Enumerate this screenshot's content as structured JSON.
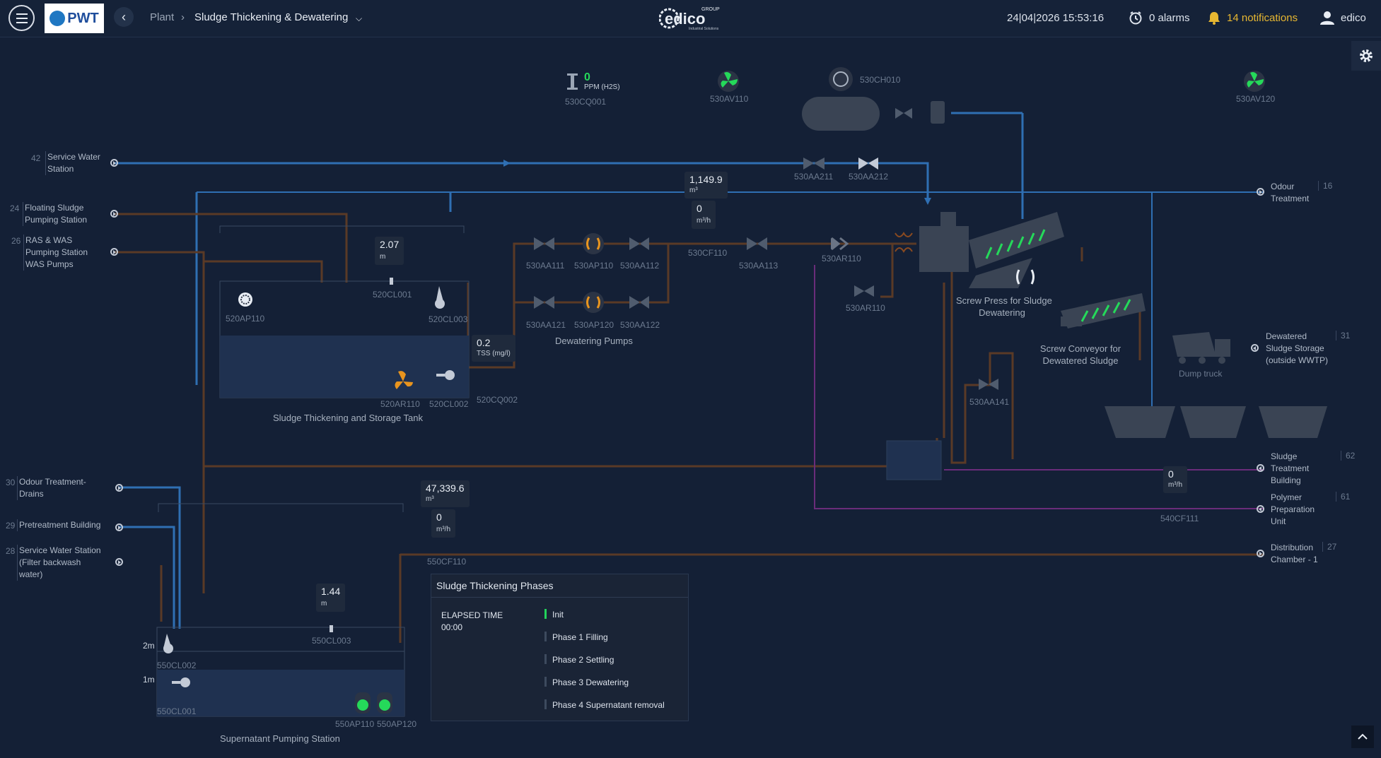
{
  "header": {
    "logo_text": "PWT",
    "crumb_root": "Plant",
    "crumb_current": "Sludge Thickening & Dewatering",
    "center_logo": "edico",
    "center_logo_group": "GROUP",
    "center_logo_sub": "Industrial Solutions",
    "datetime": "24|04|2026 15:53:16",
    "alarms": "0 alarms",
    "notifications": "14 notifications",
    "user": "edico"
  },
  "endpoints": {
    "service_water": {
      "num": "42",
      "label1": "Service Water",
      "label2": "Station"
    },
    "floating_sludge": {
      "num": "24",
      "label1": "Floating Sludge",
      "label2": "Pumping Station"
    },
    "ras_was": {
      "num": "26",
      "label1": "RAS & WAS",
      "label2": "Pumping Station",
      "label3": "WAS Pumps"
    },
    "odour_drains": {
      "num": "30",
      "label1": "Odour Treatment-",
      "label2": "Drains"
    },
    "pretreatment": {
      "num": "29",
      "label1": "Pretreatment Building"
    },
    "service_water_filter": {
      "num": "28",
      "label1": "Service Water Station",
      "label2": "(Filter backwash",
      "label3": "water)"
    },
    "odour_treatment": {
      "num": "16",
      "label1": "Odour",
      "label2": "Treatment"
    },
    "dewatered_storage": {
      "num": "31",
      "label1": "Dewatered",
      "label2": "Sludge Storage",
      "label3": "(outside WWTP)"
    },
    "sludge_treatment": {
      "num": "62",
      "label1": "Sludge",
      "label2": "Treatment",
      "label3": "Building"
    },
    "polymer": {
      "num": "61",
      "label1": "Polymer",
      "label2": "Preparation",
      "label3": "Unit"
    },
    "distribution": {
      "num": "27",
      "label1": "Distribution",
      "label2": "Chamber - 1"
    }
  },
  "tags": {
    "cq001": "530CQ001",
    "av110": "530AV110",
    "ch010": "530CH010",
    "av120": "530AV120",
    "aa211": "530AA211",
    "aa212": "530AA212",
    "cf110": "530CF110",
    "aa111": "530AA111",
    "ap110": "530AP110",
    "aa112": "530AA112",
    "aa113": "530AA113",
    "ar110a": "530AR110",
    "ar110b": "530AR110",
    "aa121": "530AA121",
    "ap120": "530AP120",
    "aa122": "530AA122",
    "aa141": "530AA141",
    "cl001": "520CL001",
    "ap110t": "520AP110",
    "cl003": "520CL003",
    "ar110t": "520AR110",
    "cl002": "520CL002",
    "cq002": "520CQ002",
    "cf111": "540CF111",
    "scf110": "550CF110",
    "s_cl003": "550CL003",
    "s_cl002": "550CL002",
    "s_cl001": "550CL001",
    "s_ap110": "550AP110",
    "s_ap120": "550AP120"
  },
  "readouts": {
    "h2s_value": "0",
    "h2s_unit": "PPM (H2S)",
    "vol_530": "1,149.9",
    "vol_530_unit": "m³",
    "flow_530": "0",
    "flow_530_unit": "m³/h",
    "level_520": "2.07",
    "level_520_unit": "m",
    "tss_520": "0.2",
    "tss_520_unit": "TSS (mg/l)",
    "flow_540": "0",
    "flow_540_unit": "m³/h",
    "vol_550": "47,339.6",
    "vol_550_unit": "m³",
    "flow_550": "0",
    "flow_550_unit": "m³/h",
    "level_550": "1.44",
    "level_550_unit": "m",
    "level_2m": "2m",
    "level_1m": "1m"
  },
  "captions": {
    "dewatering_pumps": "Dewatering Pumps",
    "screw_press": "Screw Press for Sludge",
    "screw_press2": "Dewatering",
    "screw_conveyor": "Screw Conveyor for",
    "screw_conveyor2": "Dewatered Sludge",
    "dump_truck": "Dump truck",
    "thickening_tank": "Sludge Thickening and Storage Tank",
    "supernatant": "Supernatant Pumping Station"
  },
  "phases": {
    "title": "Sludge Thickening Phases",
    "elapsed_label": "ELAPSED TIME",
    "elapsed_value": "00:00",
    "items": [
      "Init",
      "Phase 1 Filling",
      "Phase 2 Settling",
      "Phase 3 Dewatering",
      "Phase 4 Supernatant removal"
    ],
    "active_index": 0
  },
  "colors": {
    "background": "#142036",
    "water_line": "#2f6fb3",
    "sludge_line": "#5a3a26",
    "polymer_line": "#6a2c7a",
    "active_green": "#25d95a",
    "pump_orange": "#e8941e",
    "notification": "#e7b731"
  }
}
